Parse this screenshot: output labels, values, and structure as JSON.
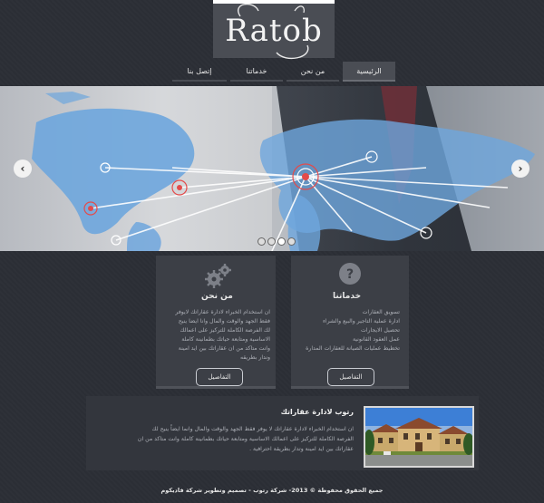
{
  "logo": {
    "text": "Ratob"
  },
  "nav": {
    "items": [
      {
        "label": "الرئيسية",
        "active": true
      },
      {
        "label": "من نحن",
        "active": false
      },
      {
        "label": "خدماتنا",
        "active": false
      },
      {
        "label": "إتصل بنا",
        "active": false
      }
    ]
  },
  "slider": {
    "dot_count": 4,
    "active_dot": 2
  },
  "about_panel": {
    "title": "من نحن",
    "lines": [
      "ان استخدام الخبراء لادارة عقاراتك لايوفر",
      "فقط الجهد والوقت والمال وانا ايضا ينيح",
      "لك الفرصة الكاملة للتركيز على اعمالك",
      "الاساسية ومتابعة حياتك بطمانينة كاملة",
      "وانت متاكد من ان عقاراتك بين ايد امينة",
      "وندار بطريقه"
    ],
    "button": "التفاصيل"
  },
  "services_panel": {
    "title": "خدماتنا",
    "lines": [
      "تسويق العقارات",
      "ادارة عملية التاجير والبيع والشراء",
      "تحصيل الايجارات",
      "عمل العقود القانونية",
      "تخطيط عمليات الصيانة للعقارات المدارة"
    ],
    "button": "التفاصيل"
  },
  "about_strip": {
    "title": "رتوب لادارة عقاراتك",
    "lines": [
      "ان استخدام الخبراء لادارة عقاراتك لا يوفر فقط الجهد والوقت والمال وانما ايضاً ينيح لك",
      "الفرصة الكاملة للتركيز على اعمالك الاساسية ومتابعة حياتك بطمانينة كاملة وانت متاكد من ان",
      "عقاراتك بين ايد امينة وتدار بطريقة احترافية ."
    ]
  },
  "footer": {
    "text": "جميع الحقوق محفوظة © 2013- شركة رتوب - تصميم وتطوير شركة فاديكوم"
  }
}
